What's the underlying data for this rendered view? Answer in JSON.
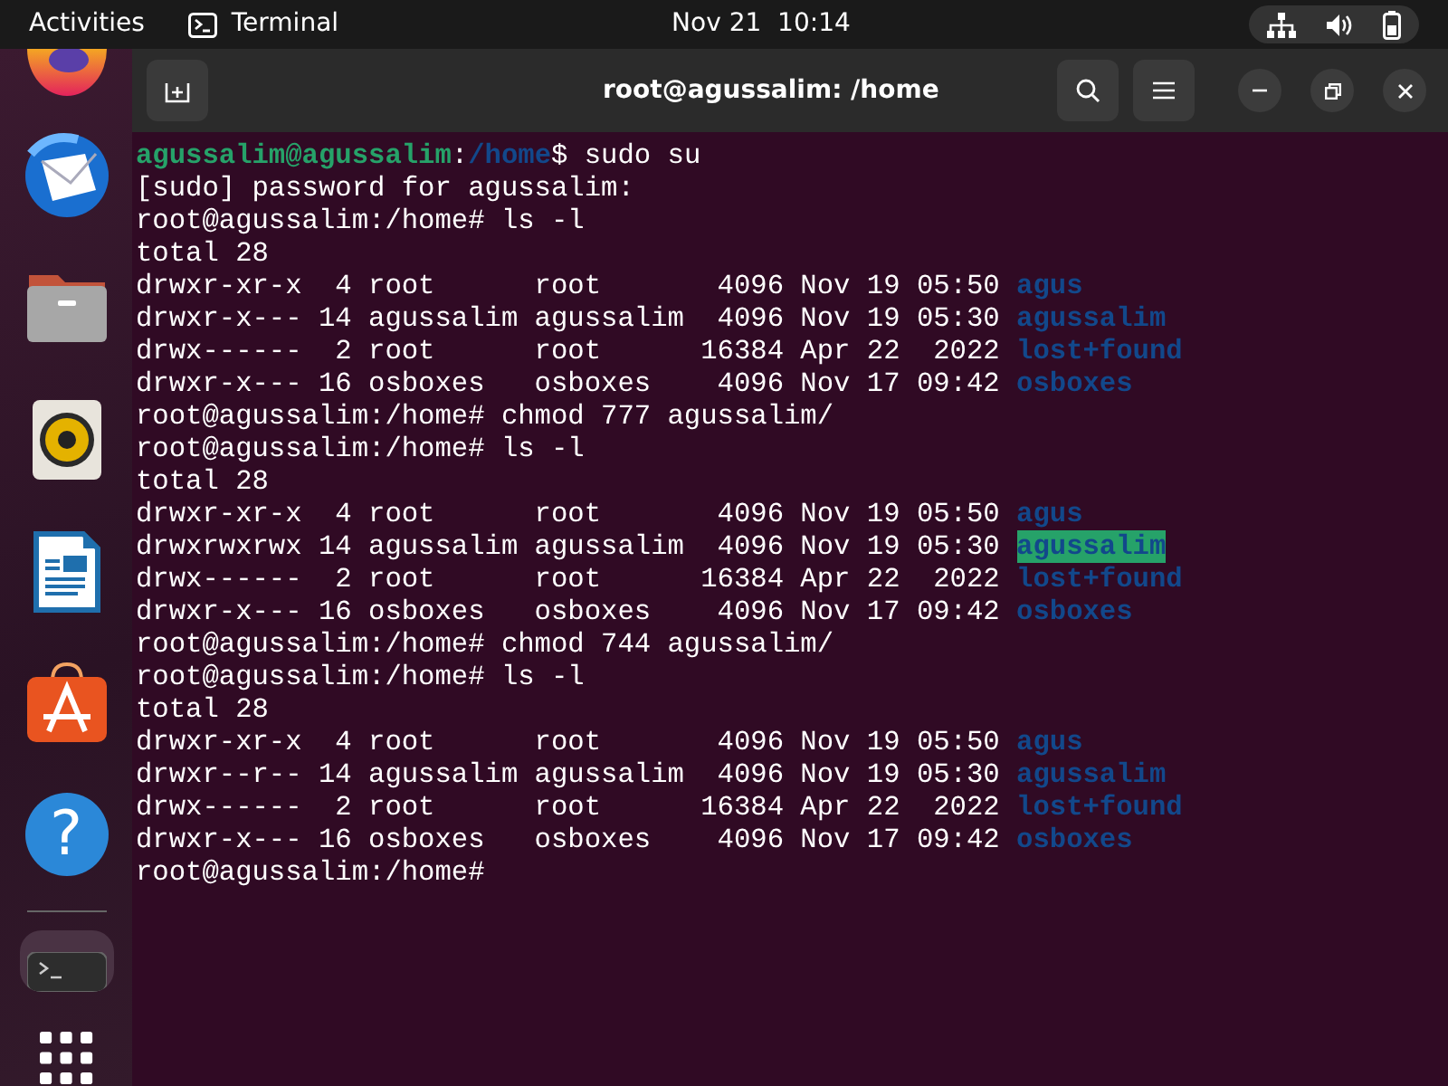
{
  "top_bar": {
    "activities": "Activities",
    "app": "Terminal",
    "clock": "Nov 21  10:14"
  },
  "dock": {
    "items": [
      {
        "kind": "firefox",
        "selected": false
      },
      {
        "kind": "mail",
        "selected": false
      },
      {
        "kind": "files",
        "selected": false
      },
      {
        "kind": "music",
        "selected": false
      },
      {
        "kind": "writer",
        "selected": false
      },
      {
        "kind": "store",
        "selected": false
      },
      {
        "kind": "help",
        "glyph": "?",
        "selected": false
      },
      {
        "kind": "terminal",
        "selected": true
      }
    ]
  },
  "window": {
    "title": "root@agussalim: /home"
  },
  "terminal": {
    "lines": [
      {
        "kind": "user_prompt",
        "user": "agussalim@agussalim",
        "sep": ":",
        "path": "/home",
        "symbol": "$",
        "command": " sudo su"
      },
      {
        "kind": "text",
        "text": "[sudo] password for agussalim:"
      },
      {
        "kind": "text",
        "text": "root@agussalim:/home# ls -l"
      },
      {
        "kind": "text",
        "text": "total 28"
      },
      {
        "kind": "entry",
        "info": "drwxr-xr-x  4 root      root       4096 Nov 19 05:50",
        "name": "agus",
        "highlighted": false
      },
      {
        "kind": "entry",
        "info": "drwxr-x--- 14 agussalim agussalim  4096 Nov 19 05:30",
        "name": "agussalim",
        "highlighted": false
      },
      {
        "kind": "entry",
        "info": "drwx------  2 root      root      16384 Apr 22  2022",
        "name": "lost+found",
        "highlighted": false
      },
      {
        "kind": "entry",
        "info": "drwxr-x--- 16 osboxes   osboxes    4096 Nov 17 09:42",
        "name": "osboxes",
        "highlighted": false
      },
      {
        "kind": "text",
        "text": "root@agussalim:/home# chmod 777 agussalim/"
      },
      {
        "kind": "text",
        "text": "root@agussalim:/home# ls -l"
      },
      {
        "kind": "text",
        "text": "total 28"
      },
      {
        "kind": "entry",
        "info": "drwxr-xr-x  4 root      root       4096 Nov 19 05:50",
        "name": "agus",
        "highlighted": false
      },
      {
        "kind": "entry",
        "info": "drwxrwxrwx 14 agussalim agussalim  4096 Nov 19 05:30",
        "name": "agussalim",
        "highlighted": true
      },
      {
        "kind": "entry",
        "info": "drwx------  2 root      root      16384 Apr 22  2022",
        "name": "lost+found",
        "highlighted": false
      },
      {
        "kind": "entry",
        "info": "drwxr-x--- 16 osboxes   osboxes    4096 Nov 17 09:42",
        "name": "osboxes",
        "highlighted": false
      },
      {
        "kind": "text",
        "text": "root@agussalim:/home# chmod 744 agussalim/"
      },
      {
        "kind": "text",
        "text": "root@agussalim:/home# ls -l"
      },
      {
        "kind": "text",
        "text": "total 28"
      },
      {
        "kind": "entry",
        "info": "drwxr-xr-x  4 root      root       4096 Nov 19 05:50",
        "name": "agus",
        "highlighted": false
      },
      {
        "kind": "entry",
        "info": "drwxr--r-- 14 agussalim agussalim  4096 Nov 19 05:30",
        "name": "agussalim",
        "highlighted": false
      },
      {
        "kind": "entry",
        "info": "drwx------  2 root      root      16384 Apr 22  2022",
        "name": "lost+found",
        "highlighted": false
      },
      {
        "kind": "entry",
        "info": "drwxr-x--- 16 osboxes   osboxes    4096 Nov 17 09:42",
        "name": "osboxes",
        "highlighted": false
      },
      {
        "kind": "text",
        "text": "root@agussalim:/home#"
      }
    ]
  }
}
